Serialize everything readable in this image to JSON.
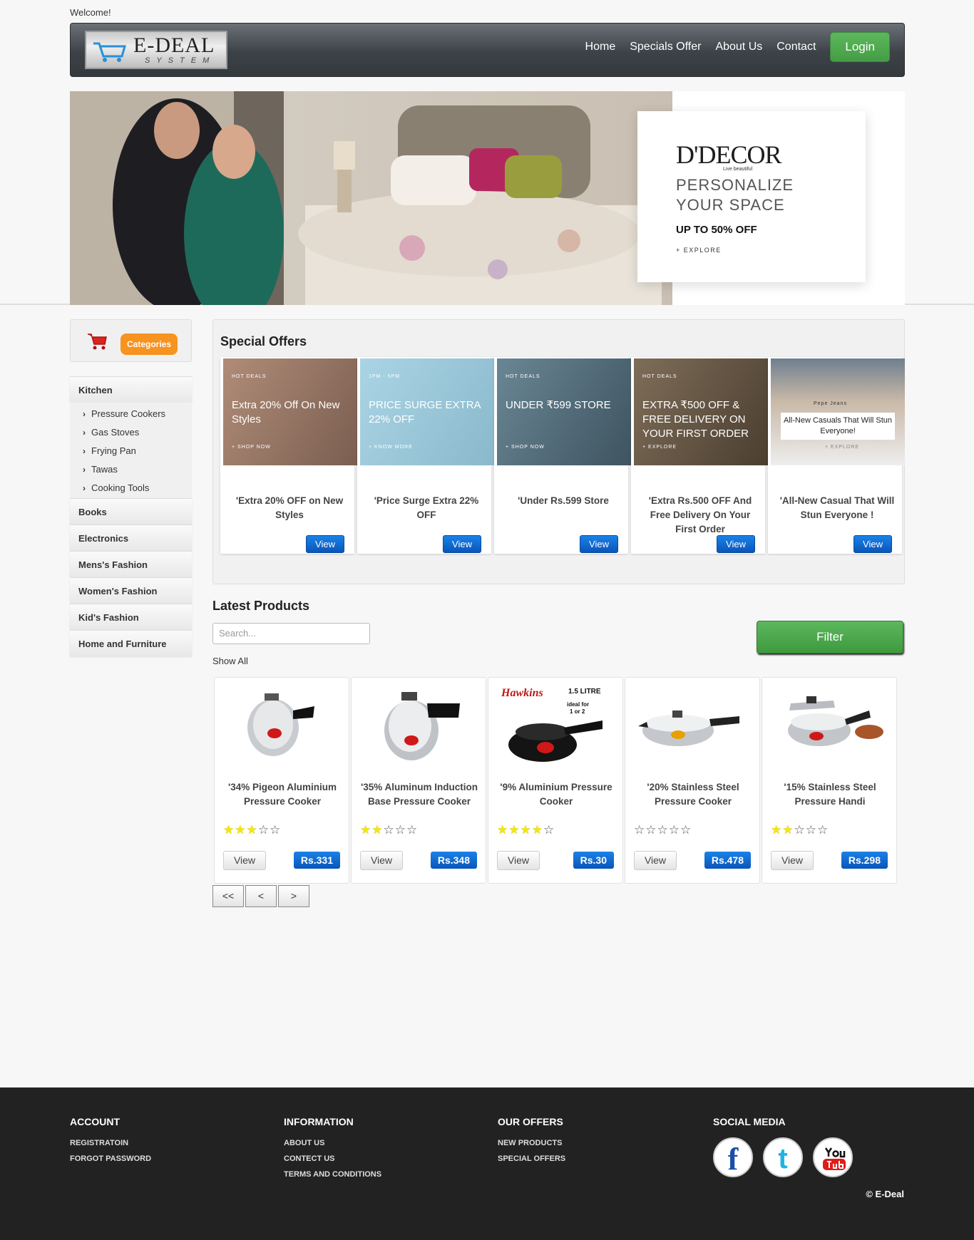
{
  "header": {
    "welcome": "Welcome!",
    "logo_text": "E-DEAL",
    "logo_sub": "SYSTEM",
    "nav": [
      "Home",
      "Specials Offer",
      "About Us",
      "Contact"
    ],
    "login": "Login"
  },
  "hero": {
    "brand": "D'DECOR",
    "tagline": "Live beautiful",
    "title": "PERSONALIZE YOUR SPACE",
    "offer": "UP TO 50% OFF",
    "explore": "+ EXPLORE"
  },
  "sidebar": {
    "categories_button": "Categories",
    "items": [
      "Kitchen",
      "Books",
      "Electronics",
      "Mens's Fashion",
      "Women's Fashion",
      "Kid's Fashion",
      "Home and Furniture"
    ],
    "kitchen_subitems": [
      "Pressure Cookers",
      "Gas Stoves",
      "Frying Pan",
      "Tawas",
      "Cooking Tools"
    ]
  },
  "special_offers": {
    "heading": "Special Offers",
    "view_label": "View",
    "items": [
      {
        "img_small": "HOT DEALS",
        "img_big": "Extra 20% Off On New Styles",
        "img_more": "+ SHOP NOW",
        "title": "'Extra 20% OFF on New Styles",
        "bg": "#9a7a6a"
      },
      {
        "img_small": "1PM - 5PM",
        "img_big": "PRICE SURGE EXTRA 22% OFF",
        "img_more": "+ KNOW MORE",
        "title": "'Price Surge Extra 22% OFF",
        "bg": "#9fc9d9"
      },
      {
        "img_small": "HOT DEALS",
        "img_big": "UNDER ₹599 STORE",
        "img_more": "+ SHOP NOW",
        "title": "'Under Rs.599 Store",
        "bg": "#556f7d"
      },
      {
        "img_small": "HOT DEALS",
        "img_big": "EXTRA ₹500 OFF & FREE DELIVERY ON YOUR FIRST ORDER",
        "img_more": "+ EXPLORE",
        "title": "'Extra Rs.500 OFF And Free Delivery On Your First Order",
        "bg": "#6a5a48"
      },
      {
        "img_small": "Pepe Jeans",
        "img_big": "All-New Casuals That Will Stun Everyone!",
        "img_more": "+ EXPLORE",
        "title": "'All-New Casual That Will Stun Everyone !",
        "bg": "#d9d2c8"
      }
    ]
  },
  "latest": {
    "heading": "Latest Products",
    "search_placeholder": "Search...",
    "filter": "Filter",
    "show_all": "Show All",
    "view_label": "View",
    "products": [
      {
        "title": "'34% Pigeon Aluminium Pressure Cooker",
        "price": "Rs.331",
        "rating": 3
      },
      {
        "title": "'35% Aluminum Induction Base Pressure Cooker",
        "price": "Rs.348",
        "rating": 2
      },
      {
        "title": "'9% Aluminium Pressure Cooker",
        "price": "Rs.30",
        "rating": 4
      },
      {
        "title": "'20% Stainless Steel Pressure Cooker",
        "price": "Rs.478",
        "rating": 0
      },
      {
        "title": "'15% Stainless Steel Pressure Handi",
        "price": "Rs.298",
        "rating": 2
      }
    ],
    "pager": [
      "<<",
      "<",
      ">"
    ]
  },
  "footer": {
    "account": {
      "title": "ACCOUNT",
      "links": [
        "REGISTRATOIN",
        "FORGOT PASSWORD"
      ]
    },
    "information": {
      "title": "INFORMATION",
      "links": [
        "ABOUT US",
        "CONTECT US",
        "TERMS AND CONDITIONS"
      ]
    },
    "offers": {
      "title": "OUR OFFERS",
      "links": [
        "NEW PRODUCTS",
        "SPECIAL OFFERS"
      ]
    },
    "social": {
      "title": "SOCIAL MEDIA",
      "icons": [
        "facebook-icon",
        "twitter-icon",
        "youtube-icon"
      ]
    },
    "copyright": "© E-Deal"
  },
  "colors": {
    "nav_bg": "#3c4247",
    "login_green": "#5cb85c",
    "offer_blue": "#0b55b8",
    "categories_orange": "#f7931e",
    "footer_bg": "#222222"
  }
}
